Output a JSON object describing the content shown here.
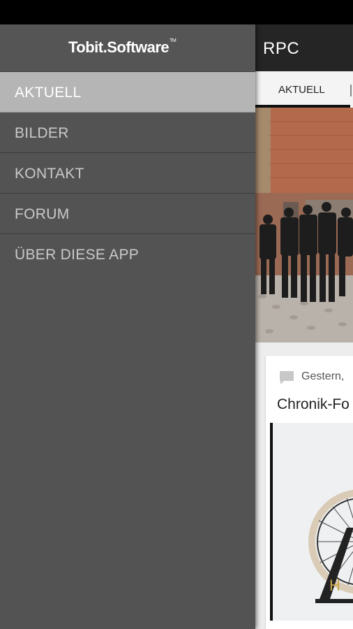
{
  "drawer": {
    "logo_text": "Tobit.Software",
    "logo_tm": "TM",
    "items": [
      {
        "label": "AKTUELL",
        "active": true
      },
      {
        "label": "BILDER",
        "active": false
      },
      {
        "label": "KONTAKT",
        "active": false
      },
      {
        "label": "FORUM",
        "active": false
      },
      {
        "label": "ÜBER DIESE APP",
        "active": false
      }
    ]
  },
  "appbar": {
    "title": "RPC"
  },
  "tabs": [
    {
      "label": "AKTUELL",
      "selected": true
    }
  ],
  "post": {
    "date": "Gestern,",
    "title": "Chronik-Fo"
  },
  "colors": {
    "drawer_bg": "#535353",
    "active_item_bg": "#b5b5b5",
    "appbar_bg": "#252525"
  }
}
